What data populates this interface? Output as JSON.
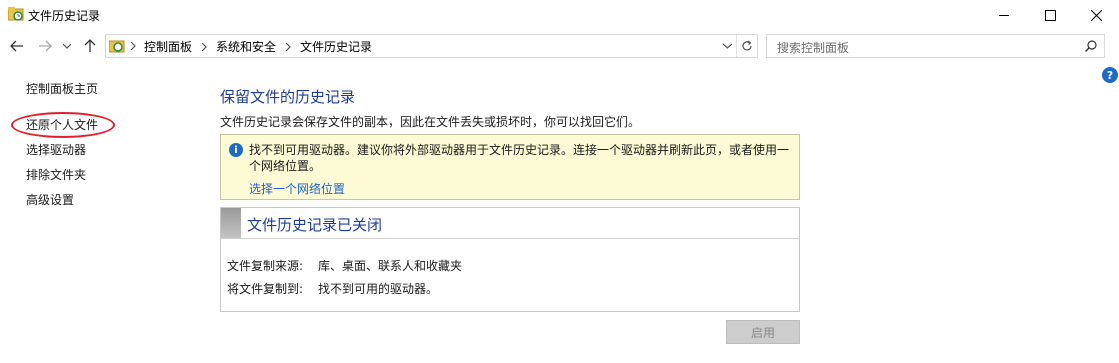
{
  "window": {
    "title": "文件历史记录"
  },
  "breadcrumb": [
    "控制面板",
    "系统和安全",
    "文件历史记录"
  ],
  "search": {
    "placeholder": "搜索控制面板"
  },
  "sidebar": {
    "home": "控制面板主页",
    "items": [
      {
        "label": "还原个人文件"
      },
      {
        "label": "选择驱动器"
      },
      {
        "label": "排除文件夹"
      },
      {
        "label": "高级设置"
      }
    ]
  },
  "main": {
    "title": "保留文件的历史记录",
    "description": "文件历史记录会保存文件的副本，因此在文件丢失或损坏时，你可以找回它们。",
    "warning": {
      "text": "找不到可用驱动器。建议你将外部驱动器用于文件历史记录。连接一个驱动器并刷新此页，或者使用一个网络位置。",
      "link": "选择一个网络位置"
    },
    "status": {
      "title": "文件历史记录已关闭",
      "source_label": "文件复制来源:",
      "source_value": "库、桌面、联系人和收藏夹",
      "target_label": "将文件复制到:",
      "target_value": "找不到可用的驱动器。"
    },
    "enable_button": "启用"
  },
  "icons": {
    "help": "?",
    "info": "i"
  },
  "colors": {
    "heading": "#1e3f8f",
    "link": "#1e63c9",
    "warning_bg": "#fcfbd5",
    "highlight_circle": "#e0202a"
  }
}
